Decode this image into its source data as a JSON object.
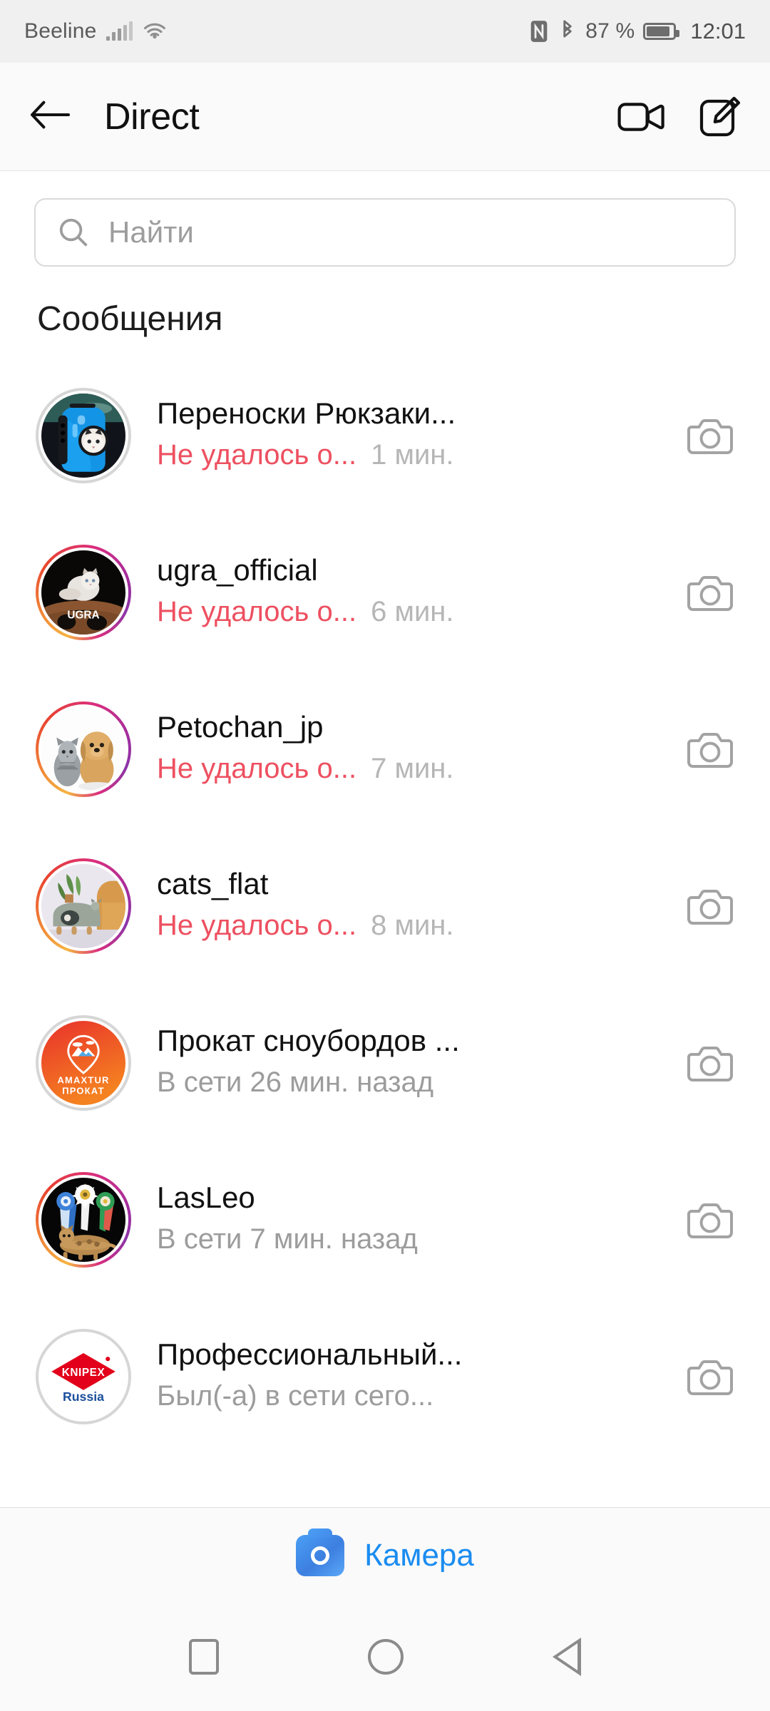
{
  "status_bar": {
    "carrier": "Beeline",
    "battery_percent": "87 %",
    "time": "12:01",
    "icons": [
      "signal-bars-icon",
      "wifi-icon",
      "nfc-icon",
      "bluetooth-icon",
      "battery-icon"
    ]
  },
  "header": {
    "title": "Direct",
    "back_icon": "back-arrow-icon",
    "video_icon": "video-camera-icon",
    "compose_icon": "compose-pencil-icon"
  },
  "search": {
    "placeholder": "Найти",
    "value": "",
    "icon": "search-icon"
  },
  "section": {
    "title": "Сообщения"
  },
  "conversations": [
    {
      "name": "Переноски Рюкзаки...",
      "status": "Не удалось о...",
      "status_type": "failed",
      "time": "1 мин.",
      "has_story": false,
      "avatar": "blue-pet-backpack-with-cat",
      "camera_icon": "camera-icon"
    },
    {
      "name": "ugra_official",
      "status": "Не удалось о...",
      "status_type": "failed",
      "time": "6 мин.",
      "has_story": true,
      "avatar": "white-cat-on-wooden-wheel-ugra",
      "camera_icon": "camera-icon"
    },
    {
      "name": "Petochan_jp",
      "status": "Не удалось о...",
      "status_type": "failed",
      "time": "7 мин.",
      "has_story": true,
      "avatar": "kitten-and-puppy",
      "camera_icon": "camera-icon"
    },
    {
      "name": "cats_flat",
      "status": "Не удалось о...",
      "status_type": "failed",
      "time": "8 мин.",
      "has_story": true,
      "avatar": "cat-furniture-in-room",
      "camera_icon": "camera-icon"
    },
    {
      "name": "Прокат сноубордов ...",
      "status": "В сети 26 мин. назад",
      "status_type": "online",
      "time": "",
      "has_story": false,
      "avatar": "amaxtur-prokat-logo",
      "camera_icon": "camera-icon"
    },
    {
      "name": "LasLeo",
      "status": "В сети 7 мин. назад",
      "status_type": "online",
      "time": "",
      "has_story": true,
      "avatar": "bengal-cat-with-rosettes",
      "camera_icon": "camera-icon"
    },
    {
      "name": "Профессиональный...",
      "status": "Был(-а) в сети сего...",
      "status_type": "online",
      "time": "",
      "has_story": false,
      "avatar": "knipex-russia-logo",
      "camera_icon": "camera-icon"
    }
  ],
  "camera_bar": {
    "label": "Камера",
    "icon": "camera-filled-icon"
  },
  "nav_bar": {
    "recents_icon": "square-recents-icon",
    "home_icon": "circle-home-icon",
    "back_icon": "triangle-back-icon"
  },
  "colors": {
    "error_red": "#ed5060",
    "link_blue": "#1a8cf0",
    "muted_gray": "#9c9c9c"
  }
}
